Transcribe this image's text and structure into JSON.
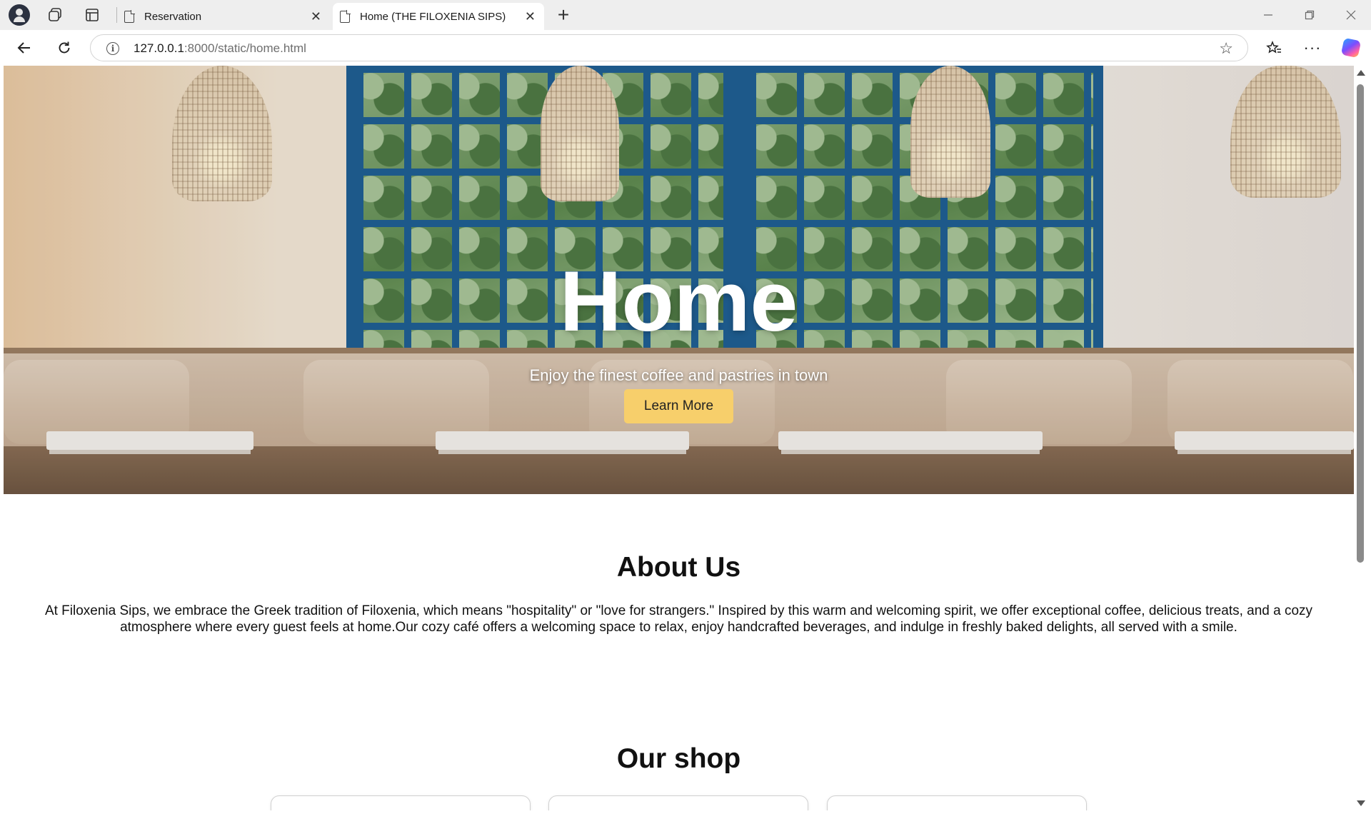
{
  "browser": {
    "tabs": [
      {
        "title": "Reservation",
        "active": false
      },
      {
        "title": "Home (THE FILOXENIA SIPS)",
        "active": true
      }
    ],
    "url_host": "127.0.0.1",
    "url_path": ":8000/static/home.html",
    "icons": [
      "profile-icon",
      "workspaces-icon",
      "vertical-tabs-icon",
      "document-icon",
      "close-icon",
      "plus-icon",
      "back-icon",
      "reload-icon",
      "info-icon",
      "star-icon",
      "favorites-icon",
      "more-icon",
      "copilot-icon"
    ]
  },
  "hero": {
    "title": "Home",
    "subtitle": "Enjoy the finest coffee and pastries in town",
    "button_label": "Learn More",
    "button_color": "#f7cf6b"
  },
  "about": {
    "heading": "About Us",
    "text": "At Filoxenia Sips, we embrace the Greek tradition of Filoxenia, which means \"hospitality\" or \"love for strangers.\" Inspired by this warm and welcoming spirit, we offer exceptional coffee, delicious treats, and a cozy atmosphere where every guest feels at home.Our cozy café offers a welcoming space to relax, enjoy handcrafted beverages, and indulge in freshly baked delights, all served with a smile."
  },
  "shop": {
    "heading": "Our shop"
  },
  "colors": {
    "window_frame": "#1f5f93",
    "accent_button": "#f7cf6b"
  }
}
